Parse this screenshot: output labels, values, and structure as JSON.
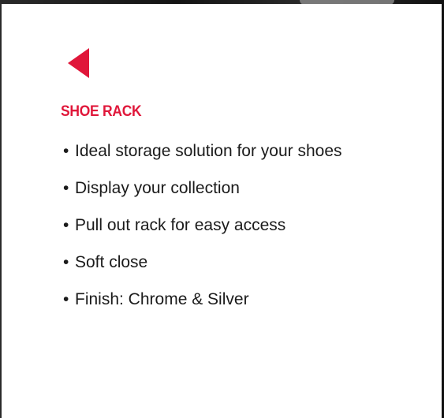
{
  "panel": {
    "title": "SHOE RACK",
    "back_icon": "triangle-left-icon",
    "accent_color": "#e0173a"
  },
  "features": [
    "Ideal storage solution for your shoes",
    "Display your collection",
    "Pull out rack for easy access",
    "Soft close",
    "Finish: Chrome & Silver"
  ]
}
